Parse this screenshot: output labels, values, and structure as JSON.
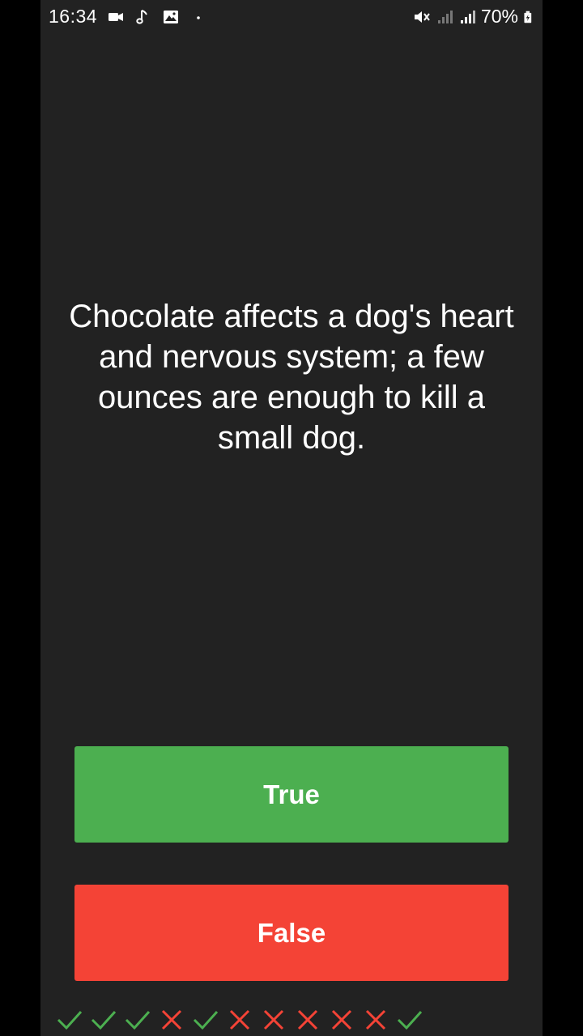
{
  "status_bar": {
    "time": "16:34",
    "battery": "70%"
  },
  "colors": {
    "background": "#222222",
    "true_button": "#4caf50",
    "false_button": "#f44336",
    "correct_mark": "#4caf50",
    "wrong_mark": "#f44336"
  },
  "question": {
    "text": "Chocolate affects a dog's heart and nervous system; a few ounces are enough to kill a small dog."
  },
  "buttons": {
    "true_label": "True",
    "false_label": "False"
  },
  "score_history": [
    {
      "result": "correct",
      "icon": "check-icon"
    },
    {
      "result": "correct",
      "icon": "check-icon"
    },
    {
      "result": "correct",
      "icon": "check-icon"
    },
    {
      "result": "wrong",
      "icon": "cross-icon"
    },
    {
      "result": "correct",
      "icon": "check-icon"
    },
    {
      "result": "wrong",
      "icon": "cross-icon"
    },
    {
      "result": "wrong",
      "icon": "cross-icon"
    },
    {
      "result": "wrong",
      "icon": "cross-icon"
    },
    {
      "result": "wrong",
      "icon": "cross-icon"
    },
    {
      "result": "wrong",
      "icon": "cross-icon"
    },
    {
      "result": "correct",
      "icon": "check-icon"
    }
  ]
}
